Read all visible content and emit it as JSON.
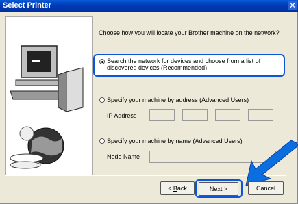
{
  "window": {
    "title": "Select Printer",
    "close_glyph": "✕"
  },
  "question": "Choose how you will locate your Brother machine on the network?",
  "options": [
    {
      "label": "Search the network for devices and choose from a list of discovered devices (Recommended)",
      "selected": true
    },
    {
      "label": "Specify your machine by address (Advanced Users)",
      "selected": false
    },
    {
      "label": "Specify your machine by name (Advanced Users)",
      "selected": false
    }
  ],
  "ip_address": {
    "label": "IP Address",
    "octets": [
      "",
      "",
      "",
      ""
    ]
  },
  "node_name": {
    "label": "Node Name",
    "value": ""
  },
  "buttons": {
    "back_prefix": "< ",
    "back_mnemonic": "B",
    "back_rest": "ack",
    "next_mnemonic": "N",
    "next_rest": "ext >",
    "cancel": "Cancel"
  },
  "colors": {
    "titlebar": "#0a5ad8",
    "highlight": "#0b55d8",
    "dialog_bg": "#ece9d8"
  },
  "icons": [
    "computer-icon",
    "tower-icon",
    "globe-icon",
    "blue-arrow-pointer"
  ]
}
